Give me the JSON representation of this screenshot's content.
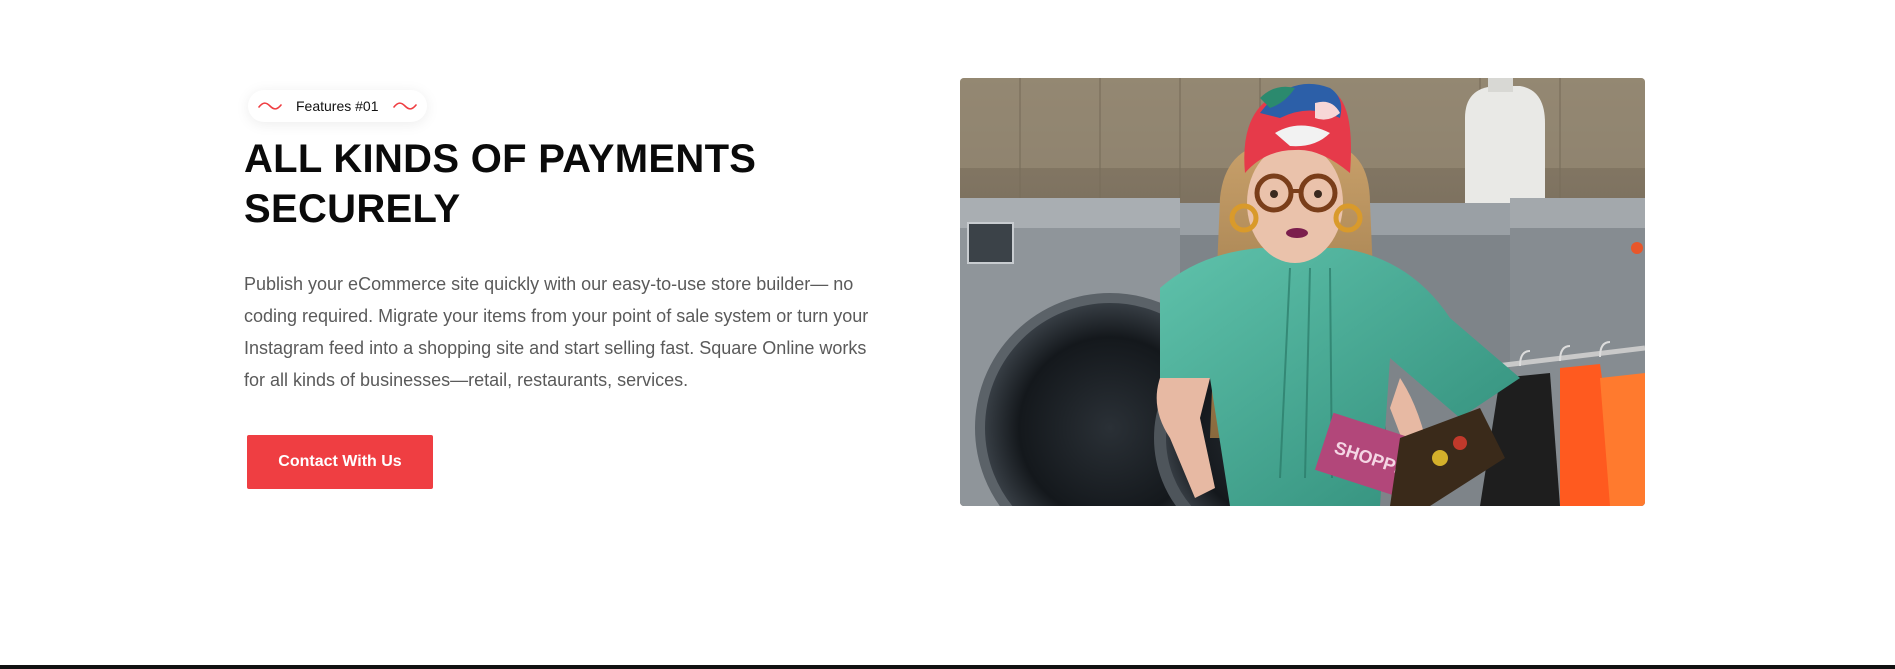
{
  "feature": {
    "badge_label": "Features #01",
    "heading_line1": "ALL KINDS OF PAYMENTS",
    "heading_line2": "SECURELY",
    "description": "Publish your eCommerce site quickly with our easy-to-use store builder— no coding required. Migrate your items from your point of sale system or turn your Instagram feed into a shopping site and start selling fast. Square Online works for all kinds of businesses—retail, restaurants, services.",
    "cta_label": "Contact With Us"
  },
  "image": {
    "bag_text": "SHOPPIN"
  },
  "colors": {
    "accent": "#ef3e42",
    "heading": "#0a0a0a",
    "body_text": "#5a5a5a"
  },
  "icons": {
    "badge_left": "wave-icon",
    "badge_right": "wave-icon"
  }
}
